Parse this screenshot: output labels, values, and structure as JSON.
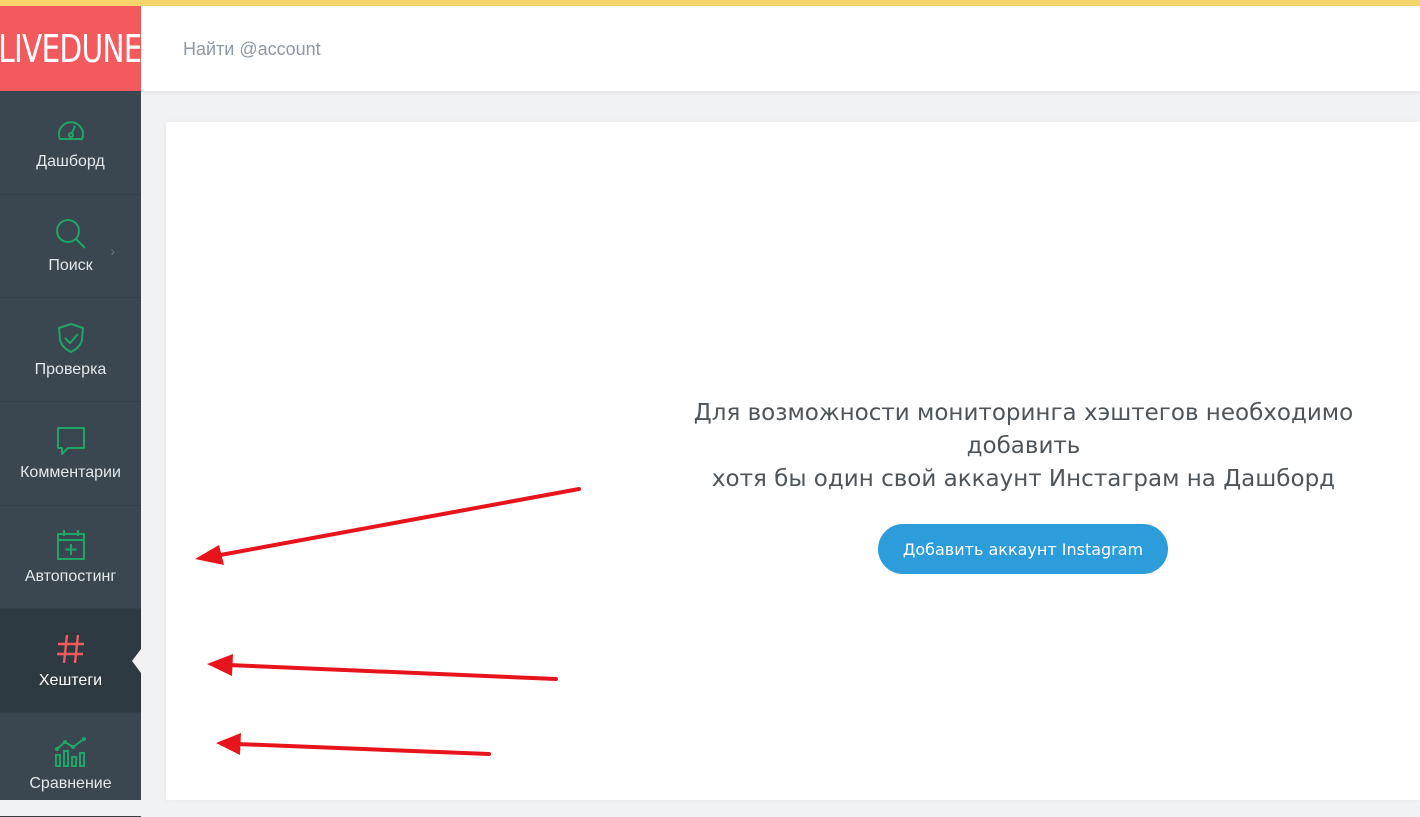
{
  "brand": {
    "logo_text": "LIVEDUNE",
    "accent": "#f35a5d"
  },
  "search": {
    "placeholder": "Найти @account",
    "value": ""
  },
  "sidebar": {
    "items": [
      {
        "label": "Дашборд",
        "icon": "dashboard-gauge-icon"
      },
      {
        "label": "Поиск",
        "icon": "search-icon",
        "has_submenu": true
      },
      {
        "label": "Проверка",
        "icon": "shield-check-icon"
      },
      {
        "label": "Комментарии",
        "icon": "comment-icon"
      },
      {
        "label": "Автопостинг",
        "icon": "calendar-plus-icon"
      },
      {
        "label": "Хештеги",
        "icon": "hashtag-icon",
        "active": true
      },
      {
        "label": "Сравнение",
        "icon": "compare-chart-icon"
      }
    ],
    "icon_color": "#1fa567",
    "active_icon_color": "#f35a5d"
  },
  "main": {
    "message_line1": "Для возможности мониторинга хэштегов необходимо добавить",
    "message_line2": "хотя бы один свой аккаунт Инстаграм на Дашборд",
    "add_button_label": "Добавить аккаунт Instagram",
    "button_color": "#2d9cdb"
  },
  "annotations": {
    "arrow_color": "#e8141b"
  }
}
